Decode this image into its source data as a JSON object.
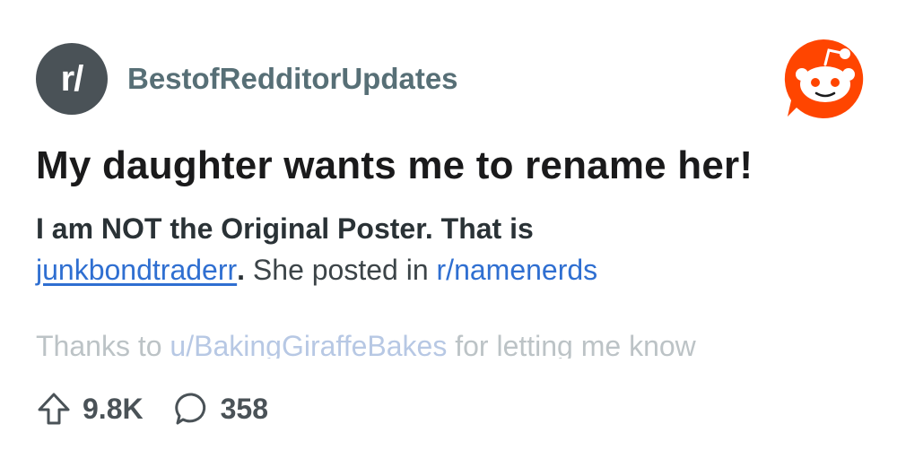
{
  "subreddit": {
    "icon_text": "r/",
    "name": "BestofRedditorUpdates"
  },
  "post": {
    "title": "My daughter wants me to rename her!",
    "body_bold": "I am NOT the Original Poster. That is",
    "op_username": "junkbondtraderr",
    "period": ".",
    "posted_in_text": " She posted in ",
    "subreddit_link": "r/namenerds",
    "fade_prefix": "Thanks to ",
    "fade_user_link": "u/BakingGiraffeBakes",
    "fade_suffix": " for letting me know"
  },
  "stats": {
    "upvotes": "9.8K",
    "comments": "358"
  },
  "icons": {
    "logo": "reddit-snoo-icon",
    "upvote": "upvote-arrow-icon",
    "comment": "comment-bubble-icon"
  },
  "colors": {
    "reddit_orange": "#ff4500",
    "link_blue": "#2f6fd1",
    "subreddit_icon_bg": "#4a5257"
  }
}
